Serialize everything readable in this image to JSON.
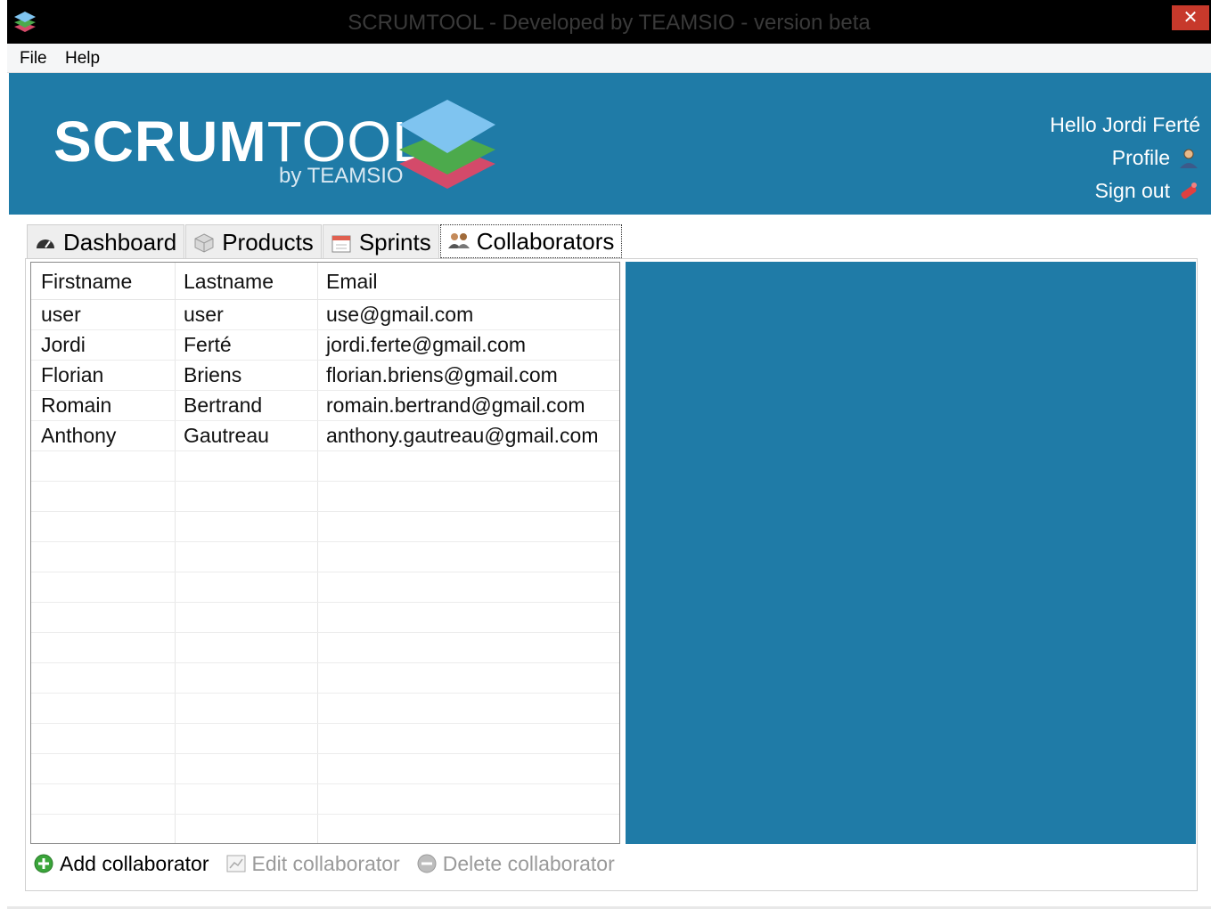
{
  "window": {
    "title": "SCRUMTOOL - Developed by TEAMSIO - version beta",
    "close_label": "✕"
  },
  "menu": {
    "items": [
      "File",
      "Help"
    ]
  },
  "header": {
    "logo_bold": "SCRUM",
    "logo_light": "TOOL",
    "logo_sub": "by TEAMSIO",
    "greeting": "Hello Jordi Ferté",
    "profile_label": "Profile",
    "signout_label": "Sign out",
    "colors": {
      "banner": "#1f7ba7",
      "stack_top": "#7fc4f0",
      "stack_mid": "#4caa4c",
      "stack_bottom": "#d44a6a"
    }
  },
  "tabs": [
    {
      "label": "Dashboard",
      "icon": "dashboard-gauge-icon",
      "active": false
    },
    {
      "label": "Products",
      "icon": "product-box-icon",
      "active": false
    },
    {
      "label": "Sprints",
      "icon": "calendar-icon",
      "active": false
    },
    {
      "label": "Collaborators",
      "icon": "users-icon",
      "active": true
    }
  ],
  "table": {
    "columns": [
      "Firstname",
      "Lastname",
      "Email"
    ],
    "rows": [
      [
        "user",
        "user",
        "use@gmail.com"
      ],
      [
        "Jordi",
        "Ferté",
        "jordi.ferte@gmail.com"
      ],
      [
        "Florian",
        "Briens",
        "florian.briens@gmail.com"
      ],
      [
        "Romain",
        "Bertrand",
        "romain.bertrand@gmail.com"
      ],
      [
        "Anthony",
        "Gautreau",
        "anthony.gautreau@gmail.com"
      ]
    ]
  },
  "actions": {
    "add_label": "Add collaborator",
    "edit_label": "Edit collaborator",
    "delete_label": "Delete collaborator"
  }
}
